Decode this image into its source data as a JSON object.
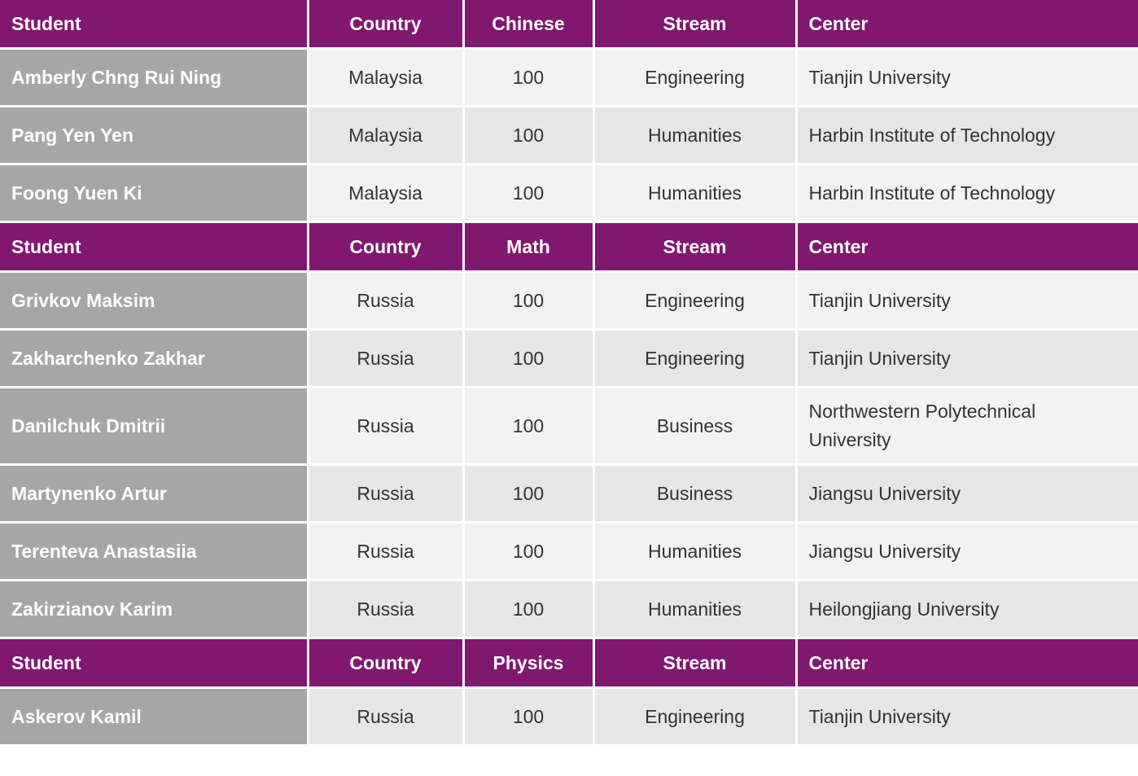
{
  "sections": [
    {
      "header": {
        "student": "Student",
        "country": "Country",
        "subject": "Chinese",
        "stream": "Stream",
        "center": "Center"
      },
      "rows": [
        {
          "student": "Amberly Chng Rui Ning",
          "country": "Malaysia",
          "score": "100",
          "stream": "Engineering",
          "center": "Tianjin University"
        },
        {
          "student": "Pang Yen Yen",
          "country": "Malaysia",
          "score": "100",
          "stream": "Humanities",
          "center": "Harbin Institute of Technology"
        },
        {
          "student": "Foong Yuen Ki",
          "country": "Malaysia",
          "score": "100",
          "stream": "Humanities",
          "center": "Harbin Institute of Technology"
        }
      ]
    },
    {
      "header": {
        "student": "Student",
        "country": "Country",
        "subject": "Math",
        "stream": "Stream",
        "center": "Center"
      },
      "rows": [
        {
          "student": "Grivkov Maksim",
          "country": "Russia",
          "score": "100",
          "stream": "Engineering",
          "center": "Tianjin University"
        },
        {
          "student": "Zakharchenko Zakhar",
          "country": "Russia",
          "score": "100",
          "stream": "Engineering",
          "center": "Tianjin University"
        },
        {
          "student": "Danilchuk Dmitrii",
          "country": "Russia",
          "score": "100",
          "stream": "Business",
          "center": "Northwestern Polytechnical University"
        },
        {
          "student": "Martynenko Artur",
          "country": "Russia",
          "score": "100",
          "stream": "Business",
          "center": "Jiangsu University"
        },
        {
          "student": "Terenteva Anastasiia",
          "country": "Russia",
          "score": "100",
          "stream": "Humanities",
          "center": "Jiangsu University"
        },
        {
          "student": "Zakirzianov Karim",
          "country": "Russia",
          "score": "100",
          "stream": "Humanities",
          "center": "Heilongjiang University"
        }
      ]
    },
    {
      "header": {
        "student": "Student",
        "country": "Country",
        "subject": "Physics",
        "stream": "Stream",
        "center": "Center"
      },
      "rows": [
        {
          "student": "Askerov Kamil",
          "country": "Russia",
          "score": "100",
          "stream": "Engineering",
          "center": "Tianjin University"
        }
      ]
    }
  ]
}
